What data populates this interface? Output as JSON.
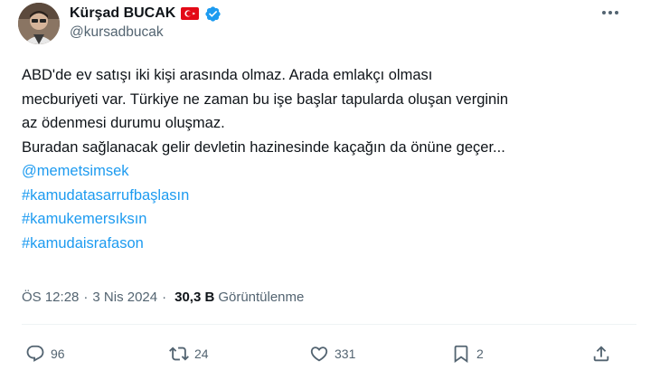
{
  "author": {
    "name": "Kürşad BUCAK",
    "handle": "@kursadbucak"
  },
  "icons": {
    "flag": "turkey-flag-icon",
    "verified": "verified-badge-icon",
    "more": "more-options-icon",
    "reply": "reply-icon",
    "retweet": "retweet-icon",
    "like": "like-icon",
    "bookmark": "bookmark-icon",
    "share": "share-icon"
  },
  "colors": {
    "link": "#1d9bf0",
    "verified": "#1d9bf0",
    "muted": "#536471",
    "text": "#0f1419"
  },
  "tweet": {
    "lines": [
      "ABD'de ev satışı iki kişi arasında olmaz. Arada emlakçı olması",
      "mecburiyeti var. Türkiye ne zaman bu işe başlar tapularda oluşan verginin",
      "az ödenmesi durumu oluşmaz.",
      "Buradan sağlanacak gelir devletin hazinesinde kaçağın da önüne geçer..."
    ],
    "mention": "@memetsimsek",
    "hashtags": [
      "#kamudatasarrufbaşlasın",
      "#kamukemersıksın",
      "#kamudaisrafason"
    ]
  },
  "meta": {
    "time": "ÖS 12:28",
    "date": "3 Nis 2024",
    "separator": "·",
    "views_count": "30,3 B",
    "views_label": "Görüntülenme"
  },
  "actions": {
    "replies": "96",
    "retweets": "24",
    "likes": "331",
    "bookmarks": "2"
  }
}
